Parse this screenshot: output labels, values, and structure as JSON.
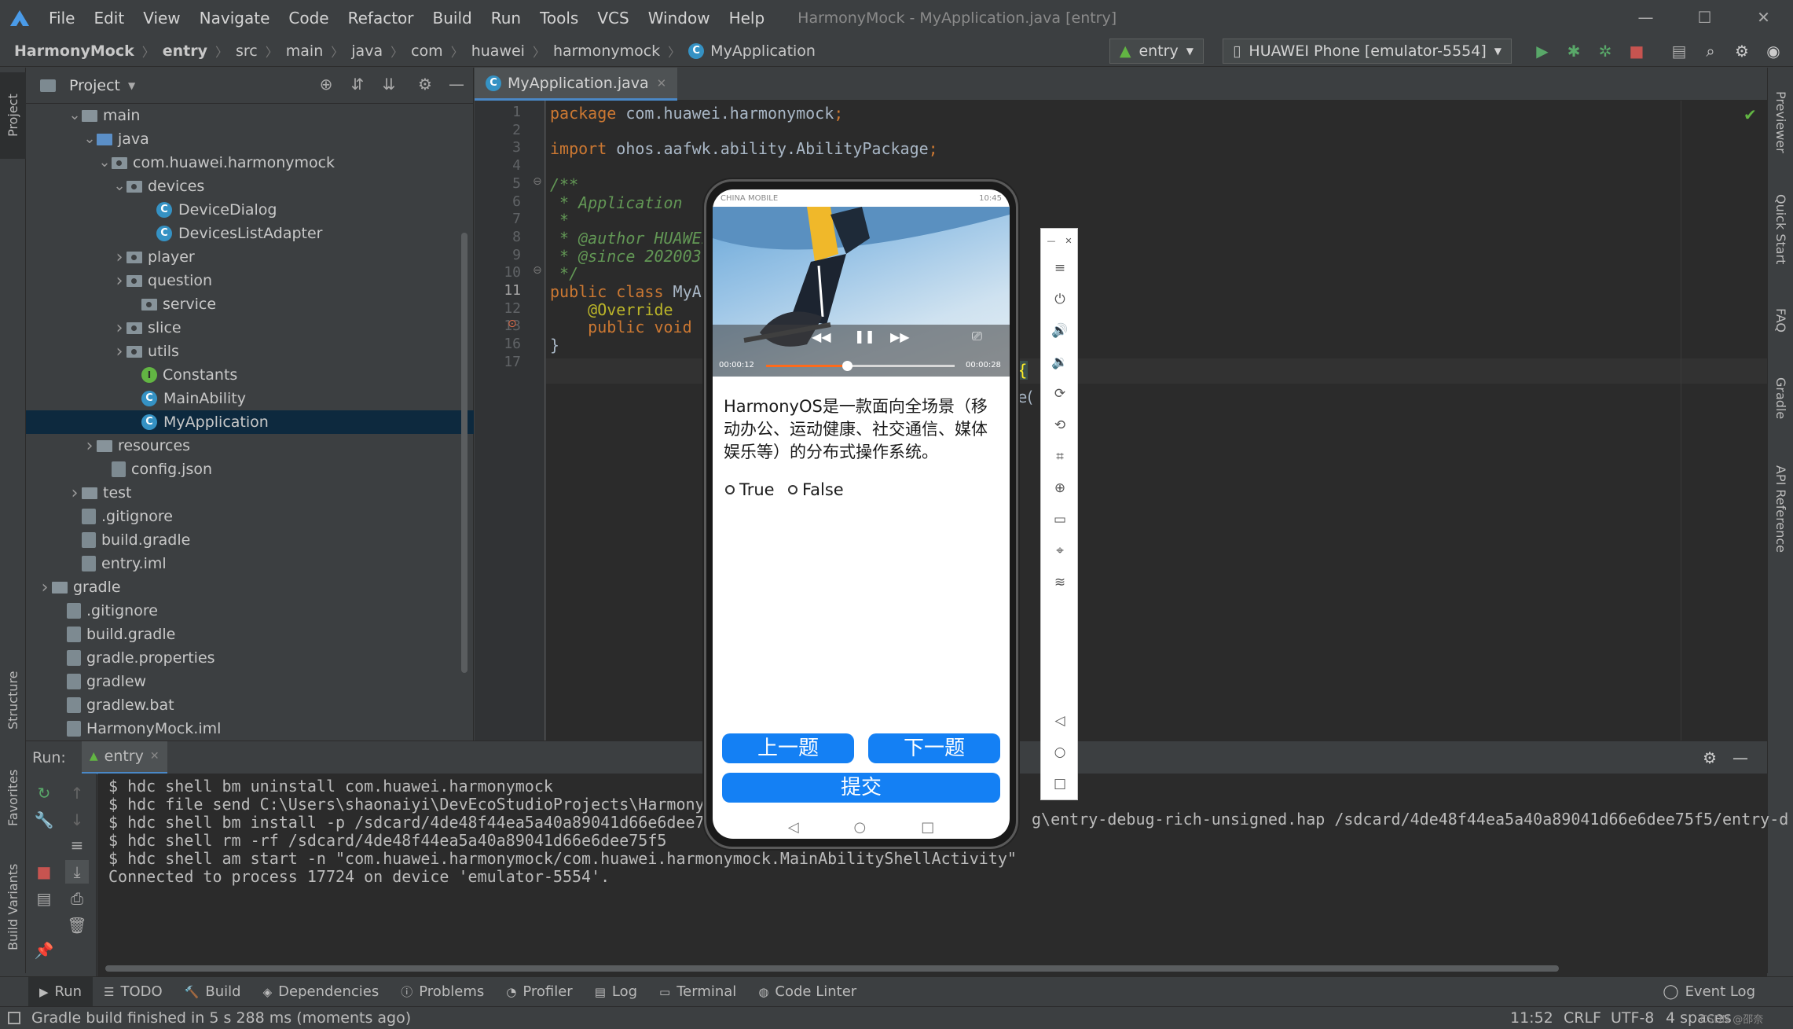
{
  "window": {
    "title": "HarmonyMock - MyApplication.java [entry]",
    "menu": [
      "File",
      "Edit",
      "View",
      "Navigate",
      "Code",
      "Refactor",
      "Build",
      "Run",
      "Tools",
      "VCS",
      "Window",
      "Help"
    ],
    "controls": {
      "minimize": "—",
      "maximize": "☐",
      "close": "✕"
    }
  },
  "breadcrumb": [
    "HarmonyMock",
    "entry",
    "src",
    "main",
    "java",
    "com",
    "huawei",
    "harmonymock",
    "MyApplication"
  ],
  "toolbar": {
    "run_config": "entry",
    "device": "HUAWEI Phone [emulator-5554]"
  },
  "left_stripe": [
    "Project",
    "Structure",
    "Favorites",
    "Build Variants"
  ],
  "right_stripe": [
    "Previewer",
    "Quick Start",
    "FAQ",
    "Gradle",
    "API Reference"
  ],
  "project_panel": {
    "title": "Project",
    "tree": [
      {
        "label": "main",
        "depth": 3,
        "type": "folder",
        "expanded": true
      },
      {
        "label": "java",
        "depth": 4,
        "type": "folder-blue",
        "expanded": true
      },
      {
        "label": "com.huawei.harmonymock",
        "depth": 5,
        "type": "package",
        "expanded": true
      },
      {
        "label": "devices",
        "depth": 6,
        "type": "package",
        "expanded": true
      },
      {
        "label": "DeviceDialog",
        "depth": 8,
        "type": "class"
      },
      {
        "label": "DevicesListAdapter",
        "depth": 8,
        "type": "class"
      },
      {
        "label": "player",
        "depth": 6,
        "type": "package",
        "expanded": false
      },
      {
        "label": "question",
        "depth": 6,
        "type": "package",
        "expanded": false
      },
      {
        "label": "service",
        "depth": 7,
        "type": "package"
      },
      {
        "label": "slice",
        "depth": 6,
        "type": "package",
        "expanded": false
      },
      {
        "label": "utils",
        "depth": 6,
        "type": "package",
        "expanded": false
      },
      {
        "label": "Constants",
        "depth": 7,
        "type": "interface"
      },
      {
        "label": "MainAbility",
        "depth": 7,
        "type": "class"
      },
      {
        "label": "MyApplication",
        "depth": 7,
        "type": "class",
        "selected": true
      },
      {
        "label": "resources",
        "depth": 4,
        "type": "folder",
        "expanded": false
      },
      {
        "label": "config.json",
        "depth": 5,
        "type": "file"
      },
      {
        "label": "test",
        "depth": 3,
        "type": "folder",
        "expanded": false
      },
      {
        "label": ".gitignore",
        "depth": 3,
        "type": "file"
      },
      {
        "label": "build.gradle",
        "depth": 3,
        "type": "file"
      },
      {
        "label": "entry.iml",
        "depth": 3,
        "type": "file"
      },
      {
        "label": "gradle",
        "depth": 1,
        "type": "folder",
        "expanded": false
      },
      {
        "label": ".gitignore",
        "depth": 2,
        "type": "file"
      },
      {
        "label": "build.gradle",
        "depth": 2,
        "type": "file"
      },
      {
        "label": "gradle.properties",
        "depth": 2,
        "type": "file"
      },
      {
        "label": "gradlew",
        "depth": 2,
        "type": "file"
      },
      {
        "label": "gradlew.bat",
        "depth": 2,
        "type": "file"
      },
      {
        "label": "HarmonyMock.iml",
        "depth": 2,
        "type": "file"
      }
    ]
  },
  "editor": {
    "tab": "MyApplication.java",
    "line_numbers": [
      "1",
      "2",
      "3",
      "4",
      "5",
      "6",
      "7",
      "8",
      "9",
      "10",
      "11",
      "12",
      "13",
      "16",
      "17"
    ],
    "lines": [
      {
        "tokens": [
          {
            "t": "package ",
            "c": "kw"
          },
          {
            "t": "com.huawei.harmonymock",
            "c": ""
          },
          {
            "t": ";",
            "c": "kw"
          }
        ]
      },
      {
        "tokens": []
      },
      {
        "tokens": [
          {
            "t": "import ",
            "c": "kw"
          },
          {
            "t": "ohos.aafwk.ability.AbilityPackage",
            "c": ""
          },
          {
            "t": ";",
            "c": "kw"
          }
        ]
      },
      {
        "tokens": []
      },
      {
        "tokens": [
          {
            "t": "/**",
            "c": "cm"
          }
        ]
      },
      {
        "tokens": [
          {
            "t": " * Application",
            "c": "cm"
          }
        ]
      },
      {
        "tokens": [
          {
            "t": " *",
            "c": "cm"
          }
        ]
      },
      {
        "tokens": [
          {
            "t": " * @author HUAWEI",
            "c": "cm"
          }
        ]
      },
      {
        "tokens": [
          {
            "t": " * @since 202003",
            "c": "cm"
          }
        ]
      },
      {
        "tokens": [
          {
            "t": " */",
            "c": "cm"
          }
        ]
      },
      {
        "tokens": [
          {
            "t": "public class ",
            "c": "kw"
          },
          {
            "t": "MyAp",
            "c": ""
          }
        ]
      },
      {
        "tokens": [
          {
            "t": "    @Override",
            "c": "an"
          }
        ]
      },
      {
        "tokens": [
          {
            "t": "    public void ",
            "c": "kw"
          }
        ]
      },
      {
        "tokens": [
          {
            "t": "}",
            "c": ""
          }
        ]
      },
      {
        "tokens": []
      }
    ]
  },
  "run_panel": {
    "label": "Run:",
    "tab": "entry",
    "console": [
      "$ hdc shell bm uninstall com.huawei.harmonymock",
      "$ hdc file send C:\\Users\\shaonaiyi\\DevEcoStudioProjects\\Harmony",
      "$ hdc shell bm install -p /sdcard/4de48f44ea5a40a89041d66e6dee75f5",
      "$ hdc shell rm -rf /sdcard/4de48f44ea5a40a89041d66e6dee75f5",
      "$ hdc shell am start -n \"com.huawei.harmonymock/com.huawei.harmonymock.MainAbilityShellActivity\"",
      "Connected to process 17724 on device 'emulator-5554'."
    ],
    "console_right_fragment": "g\\entry-debug-rich-unsigned.hap /sdcard/4de48f44ea5a40a89041d66e6dee75f5/entry-d"
  },
  "bottom_tabs": [
    "Run",
    "TODO",
    "Build",
    "Dependencies",
    "Problems",
    "Profiler",
    "Log",
    "Terminal",
    "Code Linter"
  ],
  "event_log": "Event Log",
  "status_bar": {
    "message": "Gradle build finished in 5 s 288 ms (moments ago)",
    "position": "11:52",
    "line_sep": "CRLF",
    "encoding": "UTF-8",
    "indent": "4 spaces",
    "watermark": "CSDN @邵奈"
  },
  "phone": {
    "carrier": "CHINA MOBILE",
    "clock": "10:45",
    "video": {
      "elapsed": "00:00:12",
      "total": "00:00:28",
      "progress": 0.43
    },
    "question": "HarmonyOS是一款面向全场景（移动办公、运动健康、社交通信、媒体娱乐等）的分布式操作系统。",
    "options": [
      "True",
      "False"
    ],
    "buttons": {
      "prev": "上一题",
      "next": "下一题",
      "submit": "提交"
    }
  },
  "colors": {
    "accent": "#1480f4",
    "ide_bg": "#3c3f41",
    "editor_bg": "#2b2b2b",
    "keyword": "#cc7832",
    "comment": "#629755",
    "selection": "#0d293e"
  }
}
